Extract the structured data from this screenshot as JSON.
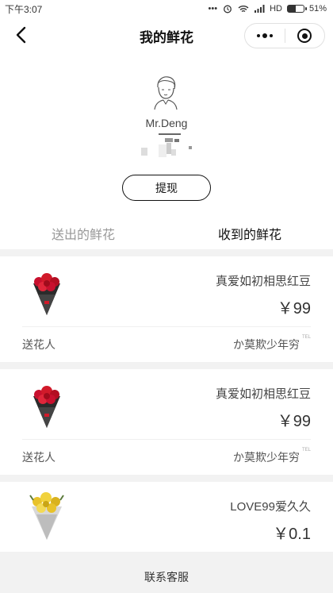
{
  "status_bar": {
    "time": "下午3:07",
    "network": "HD",
    "battery": "51%",
    "battery_level": 0.51
  },
  "nav": {
    "title": "我的鲜花"
  },
  "profile": {
    "username": "Mr.Deng",
    "withdraw_label": "提现"
  },
  "tabs": [
    {
      "label": "送出的鲜花",
      "active": false
    },
    {
      "label": "收到的鲜花",
      "active": true
    }
  ],
  "cards": [
    {
      "name": "真爱如初相思红豆",
      "price": "￥99",
      "sender_label": "送花人",
      "sender_name": "か莫欺少年穷",
      "sender_suffix": "TEL",
      "image": "red-rose-bouquet"
    },
    {
      "name": "真爱如初相思红豆",
      "price": "￥99",
      "sender_label": "送花人",
      "sender_name": "か莫欺少年穷",
      "sender_suffix": "TEL",
      "image": "red-rose-bouquet"
    },
    {
      "name": "LOVE99爱久久",
      "price": "￥0.1",
      "image": "yellow-flower-bouquet"
    }
  ],
  "footer": {
    "label": "联系客服"
  }
}
